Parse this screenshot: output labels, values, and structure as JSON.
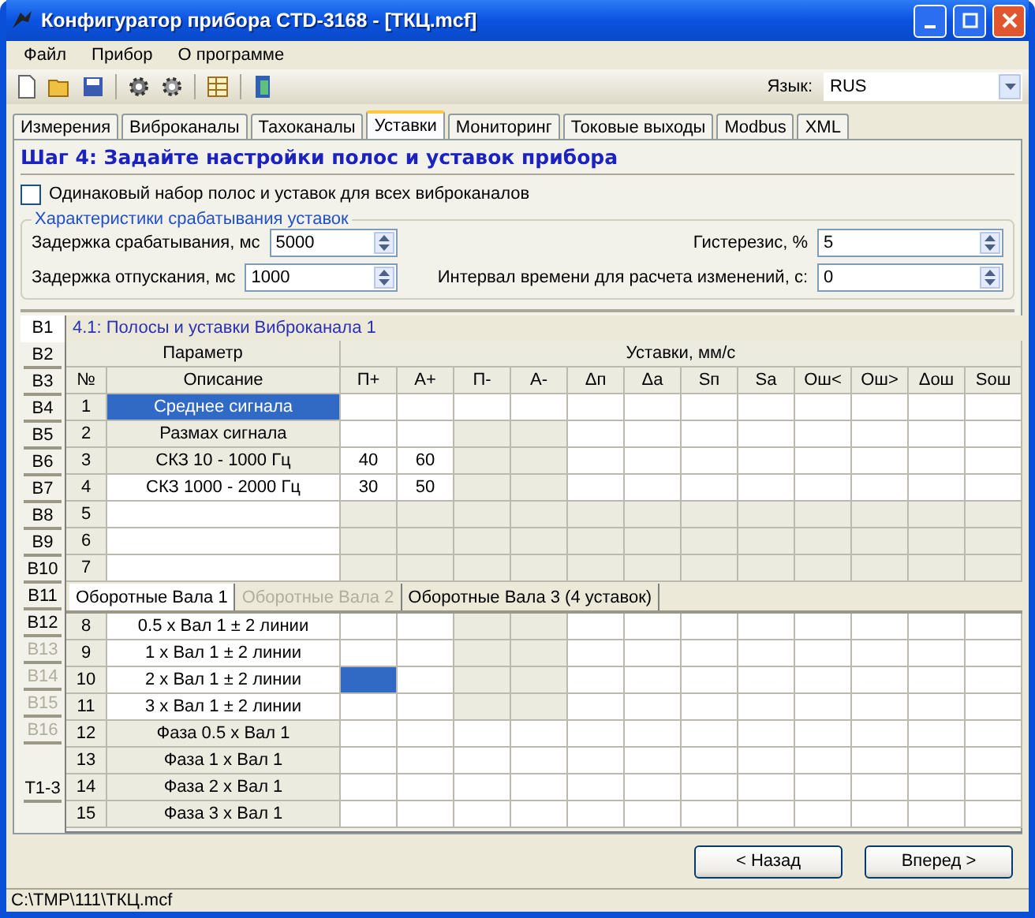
{
  "window": {
    "title": "Конфигуратор прибора CTD-3168 - [ТКЦ.mcf]"
  },
  "menu": [
    "Файл",
    "Прибор",
    "О программе"
  ],
  "toolbar": {
    "language_label": "Язык:",
    "language": "RUS"
  },
  "tabs": [
    {
      "label": "Измерения",
      "selected": false
    },
    {
      "label": "Виброканалы",
      "selected": false
    },
    {
      "label": "Тахоканалы",
      "selected": false
    },
    {
      "label": "Уставки",
      "selected": true
    },
    {
      "label": "Мониторинг",
      "selected": false
    },
    {
      "label": "Токовые выходы",
      "selected": false
    },
    {
      "label": "Modbus",
      "selected": false
    },
    {
      "label": "XML",
      "selected": false
    }
  ],
  "step_title": "Шаг 4: Задайте настройки полос и уставок прибора",
  "same_set": {
    "label": "Одинаковый набор полос и уставок для всех виброканалов",
    "checked": false
  },
  "response": {
    "title": "Характеристики срабатывания уставок",
    "fields": [
      {
        "label": "Задержка срабатывания, мс",
        "value": "5000"
      },
      {
        "label": "Гистерезис, %",
        "value": "5"
      },
      {
        "label": "Задержка отпускания, мс",
        "value": "1000"
      },
      {
        "label": "Интервал времени для расчета изменений, с:",
        "value": "0"
      }
    ]
  },
  "channel_tabs": [
    {
      "label": "В1",
      "selected": true,
      "disabled": false
    },
    {
      "label": "В2",
      "selected": false,
      "disabled": false
    },
    {
      "label": "В3",
      "selected": false,
      "disabled": false
    },
    {
      "label": "В4",
      "selected": false,
      "disabled": false
    },
    {
      "label": "В5",
      "selected": false,
      "disabled": false
    },
    {
      "label": "В6",
      "selected": false,
      "disabled": false
    },
    {
      "label": "В7",
      "selected": false,
      "disabled": false
    },
    {
      "label": "В8",
      "selected": false,
      "disabled": false
    },
    {
      "label": "В9",
      "selected": false,
      "disabled": false
    },
    {
      "label": "В10",
      "selected": false,
      "disabled": false
    },
    {
      "label": "В11",
      "selected": false,
      "disabled": false
    },
    {
      "label": "В12",
      "selected": false,
      "disabled": false
    },
    {
      "label": "В13",
      "selected": false,
      "disabled": true
    },
    {
      "label": "В14",
      "selected": false,
      "disabled": true
    },
    {
      "label": "В15",
      "selected": false,
      "disabled": true
    },
    {
      "label": "В16",
      "selected": false,
      "disabled": true
    },
    {
      "label": "Т1-3",
      "selected": false,
      "disabled": false
    }
  ],
  "table": {
    "title": "4.1: Полосы и уставки Виброканала 1",
    "group_parameter": "Параметр",
    "group_setpoints": "Уставки, мм/с",
    "columns": [
      "№",
      "Описание",
      "П+",
      "А+",
      "П-",
      "А-",
      "Δп",
      "Δа",
      "Sп",
      "Sа",
      "Ош<",
      "Ош>",
      "Δош",
      "Sош"
    ],
    "upper_rows": [
      {
        "number": "1",
        "description": "Среднее сигнала",
        "description_editable": true,
        "description_selected": true,
        "cells": [
          {
            "editable": true,
            "selected": false
          },
          {
            "editable": true,
            "selected": false
          },
          {
            "editable": true,
            "selected": false
          },
          {
            "editable": true,
            "selected": false
          },
          {
            "editable": true,
            "selected": false
          },
          {
            "editable": true,
            "selected": false
          },
          {
            "editable": true,
            "selected": false
          },
          {
            "editable": true,
            "selected": false
          },
          {
            "editable": true,
            "selected": false
          },
          {
            "editable": true,
            "selected": false
          },
          {
            "editable": true,
            "selected": false
          },
          {
            "editable": true,
            "selected": false
          }
        ]
      },
      {
        "number": "2",
        "description": "Размах сигнала",
        "description_editable": false,
        "description_selected": false,
        "cells": [
          {
            "editable": true,
            "selected": false
          },
          {
            "editable": true,
            "selected": false
          },
          {
            "editable": false,
            "selected": false
          },
          {
            "editable": false,
            "selected": false
          },
          {
            "editable": true,
            "selected": false
          },
          {
            "editable": true,
            "selected": false
          },
          {
            "editable": true,
            "selected": false
          },
          {
            "editable": true,
            "selected": false
          },
          {
            "editable": true,
            "selected": false
          },
          {
            "editable": true,
            "selected": false
          },
          {
            "editable": true,
            "selected": false
          },
          {
            "editable": true,
            "selected": false
          }
        ]
      },
      {
        "number": "3",
        "description": "СКЗ 10 - 1000 Гц",
        "description_editable": false,
        "description_selected": false,
        "cells": [
          {
            "editable": true,
            "selected": false,
            "text": "40"
          },
          {
            "editable": true,
            "selected": false,
            "text": "60"
          },
          {
            "editable": false,
            "selected": false
          },
          {
            "editable": false,
            "selected": false
          },
          {
            "editable": true,
            "selected": false
          },
          {
            "editable": true,
            "selected": false
          },
          {
            "editable": true,
            "selected": false
          },
          {
            "editable": true,
            "selected": false
          },
          {
            "editable": true,
            "selected": false
          },
          {
            "editable": true,
            "selected": false
          },
          {
            "editable": true,
            "selected": false
          },
          {
            "editable": true,
            "selected": false
          }
        ]
      },
      {
        "number": "4",
        "description": "СКЗ 1000 - 2000 Гц",
        "description_editable": true,
        "description_selected": false,
        "cells": [
          {
            "editable": true,
            "selected": false,
            "text": "30"
          },
          {
            "editable": true,
            "selected": false,
            "text": "50"
          },
          {
            "editable": false,
            "selected": false
          },
          {
            "editable": false,
            "selected": false
          },
          {
            "editable": true,
            "selected": false
          },
          {
            "editable": true,
            "selected": false
          },
          {
            "editable": true,
            "selected": false
          },
          {
            "editable": true,
            "selected": false
          },
          {
            "editable": true,
            "selected": false
          },
          {
            "editable": true,
            "selected": false
          },
          {
            "editable": true,
            "selected": false
          },
          {
            "editable": true,
            "selected": false
          }
        ]
      },
      {
        "number": "5",
        "description_editable": true,
        "description_selected": false,
        "cells": [
          {
            "editable": false,
            "selected": false
          },
          {
            "editable": false,
            "selected": false
          },
          {
            "editable": false,
            "selected": false
          },
          {
            "editable": false,
            "selected": false
          },
          {
            "editable": false,
            "selected": false
          },
          {
            "editable": false,
            "selected": false
          },
          {
            "editable": false,
            "selected": false
          },
          {
            "editable": false,
            "selected": false
          },
          {
            "editable": false,
            "selected": false
          },
          {
            "editable": false,
            "selected": false
          },
          {
            "editable": false,
            "selected": false
          },
          {
            "editable": false,
            "selected": false
          }
        ]
      },
      {
        "number": "6",
        "description_editable": true,
        "description_selected": false,
        "cells": [
          {
            "editable": false,
            "selected": false
          },
          {
            "editable": false,
            "selected": false
          },
          {
            "editable": false,
            "selected": false
          },
          {
            "editable": false,
            "selected": false
          },
          {
            "editable": false,
            "selected": false
          },
          {
            "editable": false,
            "selected": false
          },
          {
            "editable": false,
            "selected": false
          },
          {
            "editable": false,
            "selected": false
          },
          {
            "editable": false,
            "selected": false
          },
          {
            "editable": false,
            "selected": false
          },
          {
            "editable": false,
            "selected": false
          },
          {
            "editable": false,
            "selected": false
          }
        ]
      },
      {
        "number": "7",
        "description_editable": true,
        "description_selected": false,
        "cells": [
          {
            "editable": false,
            "selected": false
          },
          {
            "editable": false,
            "selected": false
          },
          {
            "editable": false,
            "selected": false
          },
          {
            "editable": false,
            "selected": false
          },
          {
            "editable": false,
            "selected": false
          },
          {
            "editable": false,
            "selected": false
          },
          {
            "editable": false,
            "selected": false
          },
          {
            "editable": false,
            "selected": false
          },
          {
            "editable": false,
            "selected": false
          },
          {
            "editable": false,
            "selected": false
          },
          {
            "editable": false,
            "selected": false
          },
          {
            "editable": false,
            "selected": false
          }
        ]
      }
    ],
    "sub_tabs": [
      {
        "label": "Оборотные Вала 1",
        "selected": true,
        "disabled": false
      },
      {
        "label": "Оборотные Вала 2",
        "selected": false,
        "disabled": true
      },
      {
        "label": "Оборотные Вала 3 (4 уставок)",
        "selected": false,
        "disabled": false
      }
    ],
    "lower_rows": [
      {
        "number": "8",
        "description": "0.5 x Вал 1 ± 2 линии",
        "description_editable": true,
        "description_selected": false,
        "cells": [
          {
            "editable": true,
            "selected": false
          },
          {
            "editable": true,
            "selected": false
          },
          {
            "editable": false,
            "selected": false
          },
          {
            "editable": false,
            "selected": false
          },
          {
            "editable": true,
            "selected": false
          },
          {
            "editable": true,
            "selected": false
          },
          {
            "editable": true,
            "selected": false
          },
          {
            "editable": true,
            "selected": false
          },
          {
            "editable": true,
            "selected": false
          },
          {
            "editable": true,
            "selected": false
          },
          {
            "editable": true,
            "selected": false
          },
          {
            "editable": true,
            "selected": false
          }
        ]
      },
      {
        "number": "9",
        "description": "1 x Вал 1 ± 2 линии",
        "description_editable": true,
        "description_selected": false,
        "cells": [
          {
            "editable": true,
            "selected": false
          },
          {
            "editable": true,
            "selected": false
          },
          {
            "editable": false,
            "selected": false
          },
          {
            "editable": false,
            "selected": false
          },
          {
            "editable": true,
            "selected": false
          },
          {
            "editable": true,
            "selected": false
          },
          {
            "editable": true,
            "selected": false
          },
          {
            "editable": true,
            "selected": false
          },
          {
            "editable": true,
            "selected": false
          },
          {
            "editable": true,
            "selected": false
          },
          {
            "editable": true,
            "selected": false
          },
          {
            "editable": true,
            "selected": false
          }
        ]
      },
      {
        "number": "10",
        "description": "2 x Вал 1 ± 2 линии",
        "description_editable": true,
        "description_selected": false,
        "cells": [
          {
            "editable": true,
            "selected": true
          },
          {
            "editable": true,
            "selected": false
          },
          {
            "editable": false,
            "selected": false
          },
          {
            "editable": false,
            "selected": false
          },
          {
            "editable": true,
            "selected": false
          },
          {
            "editable": true,
            "selected": false
          },
          {
            "editable": true,
            "selected": false
          },
          {
            "editable": true,
            "selected": false
          },
          {
            "editable": true,
            "selected": false
          },
          {
            "editable": true,
            "selected": false
          },
          {
            "editable": true,
            "selected": false
          },
          {
            "editable": true,
            "selected": false
          }
        ]
      },
      {
        "number": "11",
        "description": "3 x Вал 1 ± 2 линии",
        "description_editable": true,
        "description_selected": false,
        "cells": [
          {
            "editable": true,
            "selected": false
          },
          {
            "editable": true,
            "selected": false
          },
          {
            "editable": false,
            "selected": false
          },
          {
            "editable": false,
            "selected": false
          },
          {
            "editable": true,
            "selected": false
          },
          {
            "editable": true,
            "selected": false
          },
          {
            "editable": true,
            "selected": false
          },
          {
            "editable": true,
            "selected": false
          },
          {
            "editable": true,
            "selected": false
          },
          {
            "editable": true,
            "selected": false
          },
          {
            "editable": true,
            "selected": false
          },
          {
            "editable": true,
            "selected": false
          }
        ]
      },
      {
        "number": "12",
        "description": "Фаза 0.5 x Вал 1",
        "description_editable": false,
        "description_selected": false,
        "cells": [
          {
            "editable": true,
            "selected": false
          },
          {
            "editable": true,
            "selected": false
          },
          {
            "editable": true,
            "selected": false
          },
          {
            "editable": true,
            "selected": false
          },
          {
            "editable": true,
            "selected": false
          },
          {
            "editable": true,
            "selected": false
          },
          {
            "editable": true,
            "selected": false
          },
          {
            "editable": true,
            "selected": false
          },
          {
            "editable": true,
            "selected": false
          },
          {
            "editable": true,
            "selected": false
          },
          {
            "editable": true,
            "selected": false
          },
          {
            "editable": true,
            "selected": false
          }
        ]
      },
      {
        "number": "13",
        "description": "Фаза 1 x Вал 1",
        "description_editable": false,
        "description_selected": false,
        "cells": [
          {
            "editable": true,
            "selected": false
          },
          {
            "editable": true,
            "selected": false
          },
          {
            "editable": true,
            "selected": false
          },
          {
            "editable": true,
            "selected": false
          },
          {
            "editable": true,
            "selected": false
          },
          {
            "editable": true,
            "selected": false
          },
          {
            "editable": true,
            "selected": false
          },
          {
            "editable": true,
            "selected": false
          },
          {
            "editable": true,
            "selected": false
          },
          {
            "editable": true,
            "selected": false
          },
          {
            "editable": true,
            "selected": false
          },
          {
            "editable": true,
            "selected": false
          }
        ]
      },
      {
        "number": "14",
        "description": "Фаза 2 x Вал 1",
        "description_editable": false,
        "description_selected": false,
        "cells": [
          {
            "editable": true,
            "selected": false
          },
          {
            "editable": true,
            "selected": false
          },
          {
            "editable": true,
            "selected": false
          },
          {
            "editable": true,
            "selected": false
          },
          {
            "editable": true,
            "selected": false
          },
          {
            "editable": true,
            "selected": false
          },
          {
            "editable": true,
            "selected": false
          },
          {
            "editable": true,
            "selected": false
          },
          {
            "editable": true,
            "selected": false
          },
          {
            "editable": true,
            "selected": false
          },
          {
            "editable": true,
            "selected": false
          },
          {
            "editable": true,
            "selected": false
          }
        ]
      },
      {
        "number": "15",
        "description": "Фаза 3 x Вал 1",
        "description_editable": false,
        "description_selected": false,
        "cells": [
          {
            "editable": true,
            "selected": false
          },
          {
            "editable": true,
            "selected": false
          },
          {
            "editable": true,
            "selected": false
          },
          {
            "editable": true,
            "selected": false
          },
          {
            "editable": true,
            "selected": false
          },
          {
            "editable": true,
            "selected": false
          },
          {
            "editable": true,
            "selected": false
          },
          {
            "editable": true,
            "selected": false
          },
          {
            "editable": true,
            "selected": false
          },
          {
            "editable": true,
            "selected": false
          },
          {
            "editable": true,
            "selected": false
          },
          {
            "editable": true,
            "selected": false
          }
        ]
      }
    ]
  },
  "buttons": [
    "< Назад",
    "Вперед >"
  ],
  "status_bar": "C:\\TMP\\111\\ТКЦ.mcf"
}
